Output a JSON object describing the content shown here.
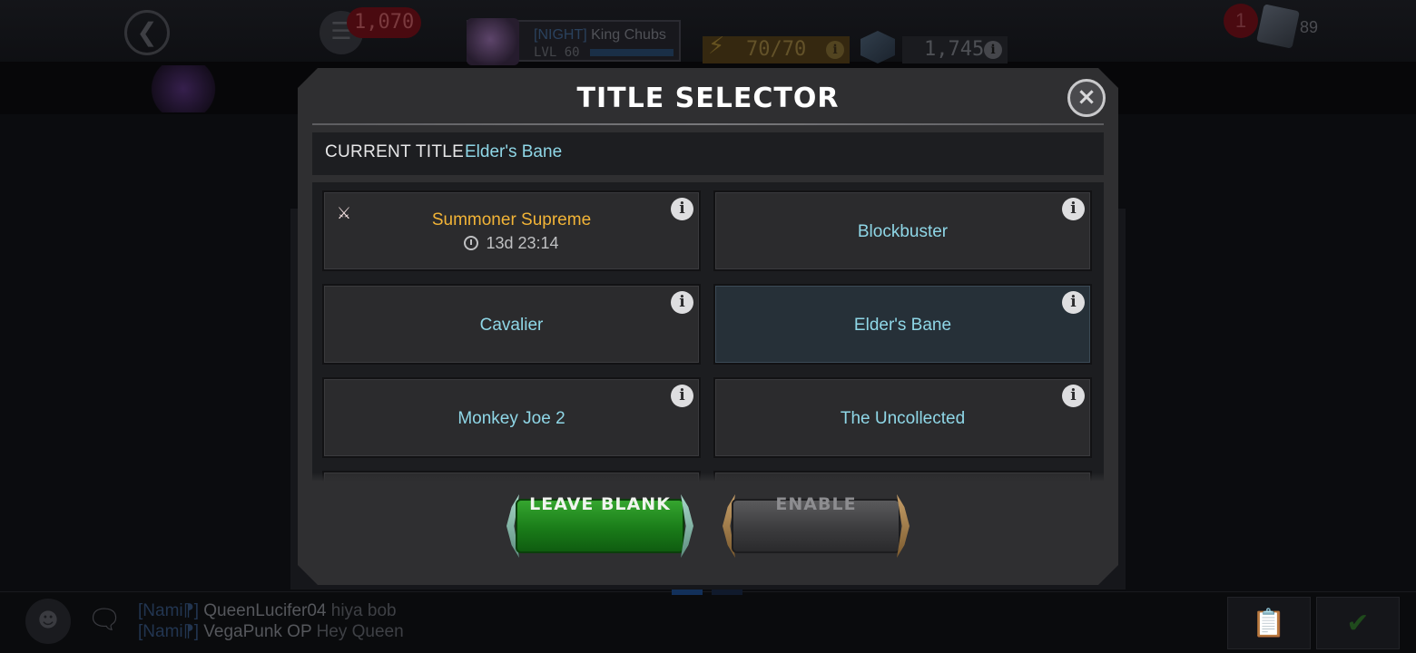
{
  "hud": {
    "chat_count": "1,070",
    "player": {
      "alliance_tag": "[NIGHT]",
      "name": "King Chubs",
      "level": "LVL 60",
      "xp_fraction": 1.0
    },
    "energy": "70/70",
    "units": "1,745",
    "notifications": "1",
    "cards": "89"
  },
  "modal": {
    "title": "TITLE SELECTOR",
    "current_label": "CURRENT TITLE",
    "current_value": "Elder's Bane",
    "titles": [
      {
        "name": "Summoner Supreme",
        "timer": "13d 23:14",
        "style": "gold"
      },
      {
        "name": "Blockbuster"
      },
      {
        "name": "Cavalier"
      },
      {
        "name": "Elder's Bane",
        "selected": true
      },
      {
        "name": "Monkey Joe 2"
      },
      {
        "name": "The Uncollected"
      }
    ],
    "leave_blank": "LEAVE BLANK",
    "enable": "ENABLE"
  },
  "chat": [
    {
      "tag": "[Nami⁋]",
      "user": "QueenLucifer04",
      "msg": "hiya bob"
    },
    {
      "tag": "[Nami⁋]",
      "user": "VegaPunk OP",
      "msg": "Hey Queen"
    }
  ],
  "colors": {
    "title_teal": "#8fd7e7",
    "title_gold": "#f2b437",
    "leave_green": "#1a7c19"
  }
}
